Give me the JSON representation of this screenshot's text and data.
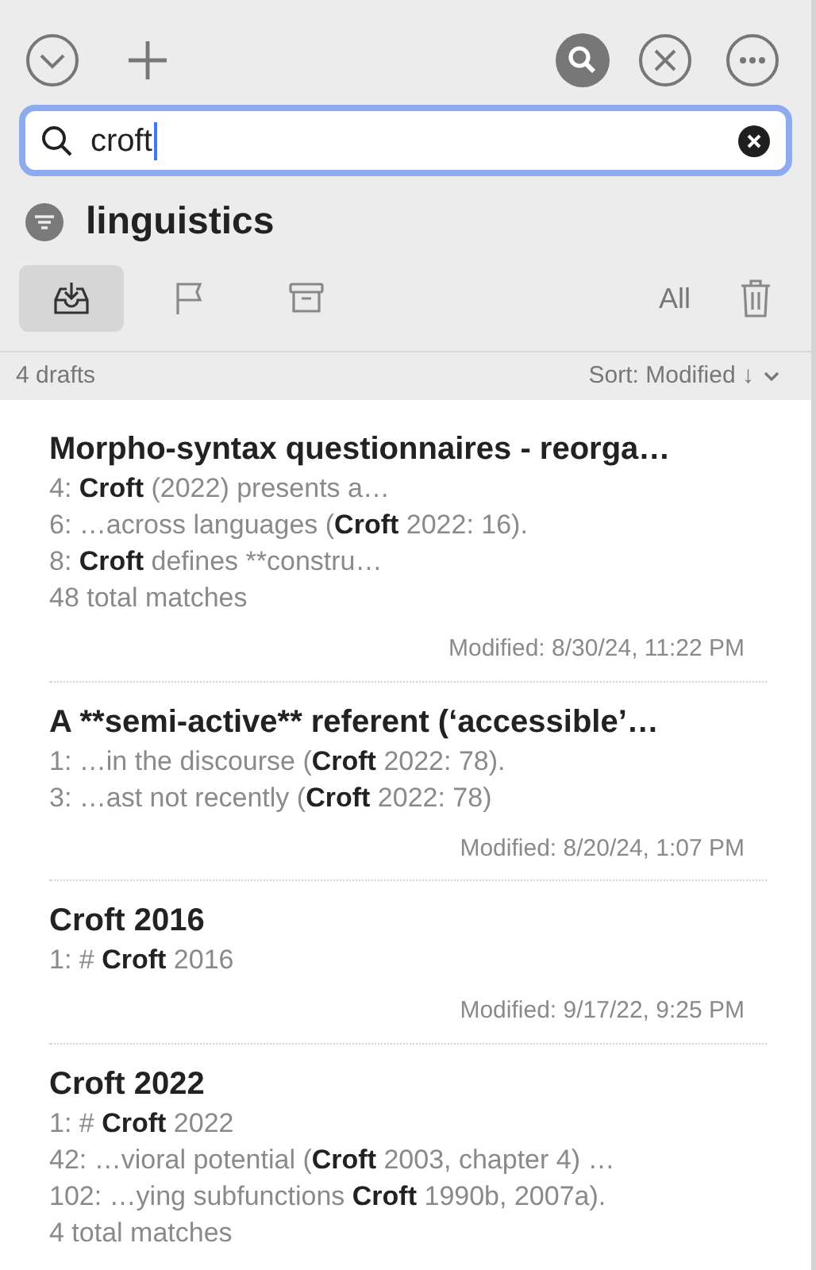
{
  "toolbar": {
    "search_active": true
  },
  "search": {
    "value": "croft"
  },
  "tag": {
    "label": "linguistics"
  },
  "filters": [
    {
      "kind": "inbox",
      "selected": true
    },
    {
      "kind": "flag",
      "selected": false
    },
    {
      "kind": "archive",
      "selected": false
    },
    {
      "kind": "all",
      "label": "All",
      "selected": false
    },
    {
      "kind": "trash",
      "selected": false
    }
  ],
  "list_header": {
    "count": "4 drafts",
    "sort": "Sort: Modified ↓"
  },
  "drafts": [
    {
      "title": "Morpho-syntax questionnaires - reorga…",
      "snippets": [
        [
          {
            "text": "4: "
          },
          {
            "text": "Croft",
            "match": true
          },
          {
            "text": " (2022) presents a…"
          }
        ],
        [
          {
            "text": "6: …across languages ("
          },
          {
            "text": "Croft",
            "match": true
          },
          {
            "text": " 2022: 16)."
          }
        ],
        [
          {
            "text": "8: "
          },
          {
            "text": "Croft",
            "match": true
          },
          {
            "text": " defines **constru…"
          }
        ]
      ],
      "total": "48 total matches",
      "modified": "Modified: 8/30/24, 11:22 PM"
    },
    {
      "title": "A **semi-active** referent (‘accessible’…",
      "snippets": [
        [
          {
            "text": "1: …in the discourse ("
          },
          {
            "text": "Croft",
            "match": true
          },
          {
            "text": " 2022: 78)."
          }
        ],
        [
          {
            "text": "3: …ast not recently ("
          },
          {
            "text": "Croft",
            "match": true
          },
          {
            "text": " 2022: 78)"
          }
        ]
      ],
      "modified": "Modified: 8/20/24, 1:07 PM"
    },
    {
      "title": "Croft 2016",
      "snippets": [
        [
          {
            "text": "1: # "
          },
          {
            "text": "Croft",
            "match": true
          },
          {
            "text": " 2016"
          }
        ]
      ],
      "modified": "Modified: 9/17/22, 9:25 PM"
    },
    {
      "title": "Croft 2022",
      "snippets": [
        [
          {
            "text": "1: # "
          },
          {
            "text": "Croft",
            "match": true
          },
          {
            "text": " 2022"
          }
        ],
        [
          {
            "text": "42: …vioral potential ("
          },
          {
            "text": "Croft",
            "match": true
          },
          {
            "text": " 2003, chapter 4) …"
          }
        ],
        [
          {
            "text": "102: …ying subfunctions "
          },
          {
            "text": "Croft",
            "match": true
          },
          {
            "text": " 1990b, 2007a)."
          }
        ]
      ],
      "total": "4 total matches"
    }
  ]
}
